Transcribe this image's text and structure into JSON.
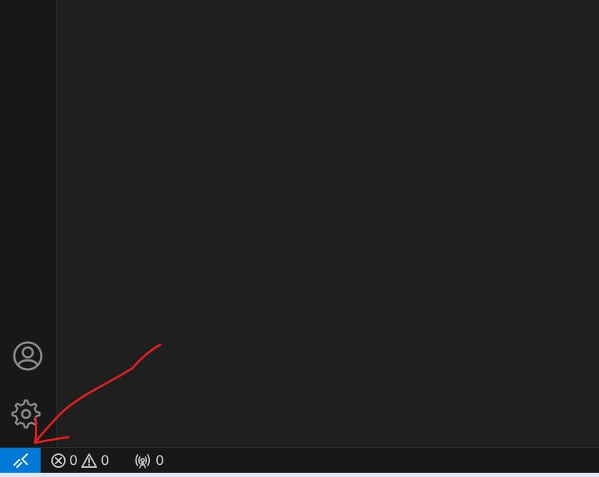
{
  "activity_bar": {
    "account_icon": "account-icon",
    "manage_icon": "gear-icon"
  },
  "status_bar": {
    "remote_icon": "remote-indicator-icon",
    "remote_color": "#0078d4",
    "errors_count": "0",
    "warnings_count": "0",
    "ports_count": "0"
  },
  "annotation": {
    "color": "#e02020",
    "shape": "hand-drawn-arrow"
  }
}
